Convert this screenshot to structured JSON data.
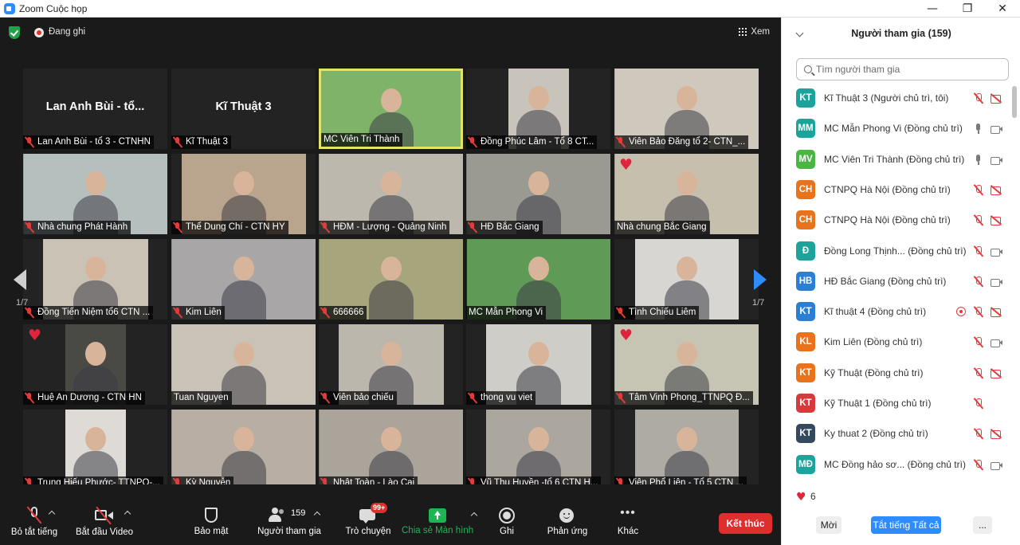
{
  "window": {
    "title": "Zoom Cuộc họp",
    "controls": [
      "—",
      "❐",
      "✕"
    ]
  },
  "topbar": {
    "recording_label": "Đang ghi",
    "view_label": "Xem"
  },
  "pagination": {
    "left": "1/7",
    "right": "1/7"
  },
  "tiles": [
    {
      "label": "Lan Anh Bùi - tổ 3 - CTNHN",
      "big_name": "Lan Anh Bùi - tổ...",
      "muted": true,
      "video": false,
      "heart": false,
      "active": false,
      "bg": "#232323",
      "fg": "#232323"
    },
    {
      "label": "Kĩ Thuật 3",
      "big_name": "Kĩ Thuật 3",
      "muted": true,
      "video": false,
      "heart": false,
      "active": false,
      "bg": "#232323",
      "fg": "#232323"
    },
    {
      "label": "MC Viên Tri Thành",
      "big_name": "",
      "muted": false,
      "video": true,
      "heart": false,
      "active": true,
      "bg": "#5f8f4e",
      "fg": "#7fb36a"
    },
    {
      "label": "Đồng Phúc Lâm - Tổ 8 CT...",
      "big_name": "",
      "muted": true,
      "video": true,
      "heart": false,
      "active": false,
      "bg": "#232323",
      "fg": "#c9c4bb"
    },
    {
      "label": "Viên Bảo Đăng tổ 2- CTN_...",
      "big_name": "",
      "muted": true,
      "video": true,
      "heart": false,
      "active": false,
      "bg": "#b7b4ab",
      "fg": "#cfc8bd"
    },
    {
      "label": "Nhà chung Phát Hành",
      "big_name": "",
      "muted": true,
      "video": true,
      "heart": false,
      "active": false,
      "bg": "#9aa8a8",
      "fg": "#b5bfbd"
    },
    {
      "label": "Thể Dung Chí - CTN HY",
      "big_name": "",
      "muted": true,
      "video": true,
      "heart": false,
      "active": false,
      "bg": "#232323",
      "fg": "#b9a58d"
    },
    {
      "label": "HĐM - Lượng - Quảng Ninh",
      "big_name": "",
      "muted": true,
      "video": true,
      "heart": false,
      "active": false,
      "bg": "#a8a49c",
      "fg": "#bdb8ae"
    },
    {
      "label": "HĐ Bắc Giang",
      "big_name": "",
      "muted": true,
      "video": true,
      "heart": false,
      "active": false,
      "bg": "#7d7e7a",
      "fg": "#9b9a92"
    },
    {
      "label": "Nhà chung Bắc Giang",
      "big_name": "",
      "muted": false,
      "video": true,
      "heart": true,
      "active": false,
      "bg": "#a8a194",
      "fg": "#c7bfae"
    },
    {
      "label": "Đồng Tiến Niệm tổ6 CTN ...",
      "big_name": "",
      "muted": true,
      "video": true,
      "heart": false,
      "active": false,
      "bg": "#232323",
      "fg": "#c9c2b5"
    },
    {
      "label": "Kim Liên",
      "big_name": "",
      "muted": true,
      "video": true,
      "heart": false,
      "active": false,
      "bg": "#8d8f96",
      "fg": "#a9a6a8"
    },
    {
      "label": "666666",
      "big_name": "",
      "muted": true,
      "video": true,
      "heart": false,
      "active": false,
      "bg": "#7e8467",
      "fg": "#a7a57c"
    },
    {
      "label": "MC Mẫn Phong Vi",
      "big_name": "",
      "muted": false,
      "video": true,
      "heart": false,
      "active": false,
      "bg": "#232323",
      "fg": "#5f9a57"
    },
    {
      "label": "Tình Chiếu Liêm",
      "big_name": "",
      "muted": true,
      "video": true,
      "heart": false,
      "active": false,
      "bg": "#232323",
      "fg": "#d8d6d2"
    },
    {
      "label": "Huệ An Dương - CTN HN",
      "big_name": "",
      "muted": true,
      "video": true,
      "heart": true,
      "active": false,
      "bg": "#232323",
      "fg": "#4a4a45"
    },
    {
      "label": "Tuan Nguyen",
      "big_name": "",
      "muted": false,
      "video": true,
      "heart": false,
      "active": false,
      "bg": "#b6b0a8",
      "fg": "#c9c2b7"
    },
    {
      "label": "Viên bảo chiếu",
      "big_name": "",
      "muted": true,
      "video": true,
      "heart": false,
      "active": false,
      "bg": "#232323",
      "fg": "#bcb7ad"
    },
    {
      "label": "thong vu viet",
      "big_name": "",
      "muted": true,
      "video": true,
      "heart": false,
      "active": false,
      "bg": "#232323",
      "fg": "#cfcdc8"
    },
    {
      "label": "Tâm Vinh Phong_TTNPQ Đ...",
      "big_name": "",
      "muted": true,
      "video": true,
      "heart": true,
      "active": false,
      "bg": "#aeb0a0",
      "fg": "#c6c5b4"
    },
    {
      "label": "Trung Hiếu Phước- TTNPQ-...",
      "big_name": "",
      "muted": true,
      "video": true,
      "heart": false,
      "active": false,
      "bg": "#232323",
      "fg": "#dedbd6"
    },
    {
      "label": "Kỳ Nguyễn",
      "big_name": "",
      "muted": true,
      "video": true,
      "heart": false,
      "active": false,
      "bg": "#9c938b",
      "fg": "#b9aea3"
    },
    {
      "label": "Nhật Toàn - Lào Cai",
      "big_name": "",
      "muted": true,
      "video": true,
      "heart": false,
      "active": false,
      "bg": "#8e8a84",
      "fg": "#aaa49b"
    },
    {
      "label": "Vũ Thu Huyền -tổ 6 CTN H...",
      "big_name": "",
      "muted": true,
      "video": true,
      "heart": false,
      "active": false,
      "bg": "#232323",
      "fg": "#aba79f"
    },
    {
      "label": "Viên Phổ Liên - Tổ 5 CTN ...",
      "big_name": "",
      "muted": true,
      "video": true,
      "heart": false,
      "active": false,
      "bg": "#232323",
      "fg": "#aeaba4"
    }
  ],
  "toolbar": {
    "mute_all": "Bỏ tắt tiếng",
    "start_video": "Bắt đầu Video",
    "security": "Bảo mật",
    "participants": "Người tham gia",
    "participants_count": "159",
    "chat": "Trò chuyện",
    "chat_badge": "99+",
    "share": "Chia sẻ Màn hình",
    "record": "Ghi",
    "reactions": "Phản ứng",
    "more": "Khác",
    "end": "Kết thúc"
  },
  "panel": {
    "title": "Người tham gia (159)",
    "search_placeholder": "Tìm người tham gia",
    "participants": [
      {
        "initials": "KT",
        "color": "#1ba39c",
        "name": "Kĩ Thuật 3 (Người chủ trì, tôi)",
        "mic": "off",
        "video": "off",
        "rec": false
      },
      {
        "initials": "MM",
        "color": "#1ba39c",
        "name": "MC Mẫn Phong Vi (Đồng chủ trì)",
        "mic": "on",
        "video": "on",
        "rec": false
      },
      {
        "initials": "MV",
        "color": "#4bb543",
        "name": "MC Viên Tri Thành (Đồng chủ trì)",
        "mic": "on",
        "video": "on",
        "rec": false
      },
      {
        "initials": "CH",
        "color": "#e8731c",
        "name": "CTNPQ Hà Nội (Đồng chủ trì)",
        "mic": "off",
        "video": "off",
        "rec": false
      },
      {
        "initials": "CH",
        "color": "#e8731c",
        "name": "CTNPQ Hà Nội (Đồng chủ trì)",
        "mic": "off",
        "video": "off",
        "rec": false
      },
      {
        "initials": "Đ",
        "color": "#1ba39c",
        "name": "Đồng Long Thịnh... (Đồng chủ trì)",
        "mic": "off",
        "video": "on",
        "rec": false
      },
      {
        "initials": "HB",
        "color": "#2a7fd4",
        "name": "HĐ Bắc Giang (Đồng chủ trì)",
        "mic": "off",
        "video": "on",
        "rec": false
      },
      {
        "initials": "KT",
        "color": "#2a7fd4",
        "name": "Kĩ thuật 4 (Đồng chủ trì)",
        "mic": "off",
        "video": "off",
        "rec": true
      },
      {
        "initials": "KL",
        "color": "#e8731c",
        "name": "Kim Liên (Đồng chủ trì)",
        "mic": "off",
        "video": "on",
        "rec": false
      },
      {
        "initials": "KT",
        "color": "#e8731c",
        "name": "Kỹ Thuật (Đồng chủ trì)",
        "mic": "off",
        "video": "off",
        "rec": false
      },
      {
        "initials": "KT",
        "color": "#d63a3a",
        "name": "Kỹ Thuật 1 (Đồng chủ trì)",
        "mic": "off",
        "video": "none",
        "rec": false
      },
      {
        "initials": "KT",
        "color": "#34495e",
        "name": "Ky thuat 2 (Đồng chủ trì)",
        "mic": "off",
        "video": "off",
        "rec": false
      },
      {
        "initials": "MĐ",
        "color": "#1ba39c",
        "name": "MC Đồng hảo sơ... (Đồng chủ trì)",
        "mic": "off",
        "video": "on",
        "rec": false
      }
    ],
    "reaction_icon": "heart-icon",
    "reaction_count": "6",
    "invite": "Mời",
    "mute_all": "Tắt tiếng Tất cả",
    "more": "..."
  }
}
